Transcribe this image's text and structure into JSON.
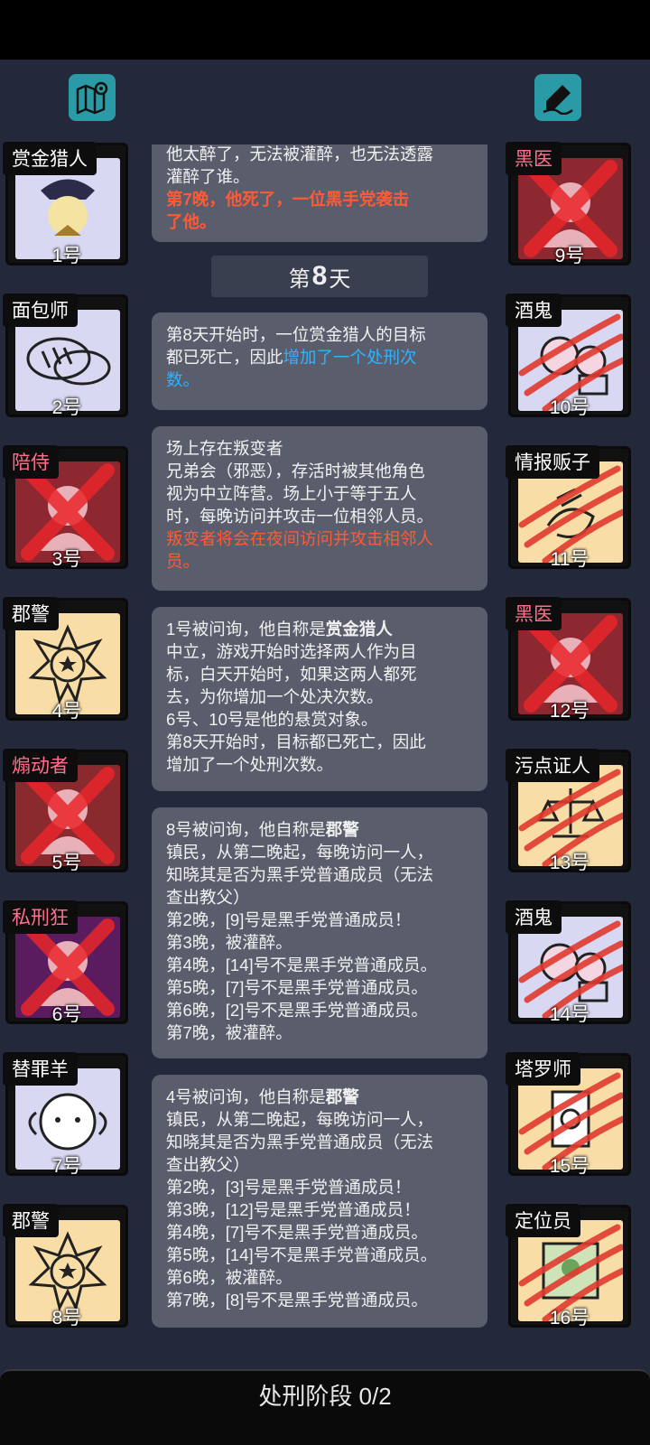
{
  "toolbar": {
    "map_icon": "map-pin-icon",
    "edit_icon": "pen-icon"
  },
  "left_players": [
    {
      "name": "赏金猎人",
      "num": "1号",
      "dead": false,
      "bg": "#d9d8f2"
    },
    {
      "name": "面包师",
      "num": "2号",
      "dead": false,
      "bg": "#d9d8f2"
    },
    {
      "name": "陪侍",
      "num": "3号",
      "dead": true,
      "bg": "#8e2830"
    },
    {
      "name": "郡警",
      "num": "4号",
      "dead": false,
      "bg": "#f9dda6"
    },
    {
      "name": "煽动者",
      "num": "5号",
      "dead": true,
      "bg": "#8a2a2e"
    },
    {
      "name": "私刑狂",
      "num": "6号",
      "dead": true,
      "bg": "#5a1c5e"
    },
    {
      "name": "替罪羊",
      "num": "7号",
      "dead": false,
      "bg": "#d9d8f2"
    },
    {
      "name": "郡警",
      "num": "8号",
      "dead": false,
      "bg": "#f9dda6"
    }
  ],
  "right_players": [
    {
      "name": "黑医",
      "num": "9号",
      "dead": true,
      "bg": "#8e2830"
    },
    {
      "name": "酒鬼",
      "num": "10号",
      "dead": false,
      "bg": "#d9d8f2"
    },
    {
      "name": "情报贩子",
      "num": "11号",
      "dead": false,
      "bg": "#f9dda6"
    },
    {
      "name": "黑医",
      "num": "12号",
      "dead": true,
      "bg": "#8e2830"
    },
    {
      "name": "污点证人",
      "num": "13号",
      "dead": false,
      "bg": "#f9dda6"
    },
    {
      "name": "酒鬼",
      "num": "14号",
      "dead": false,
      "bg": "#d9d8f2"
    },
    {
      "name": "塔罗师",
      "num": "15号",
      "dead": false,
      "bg": "#f9dda6"
    },
    {
      "name": "定位员",
      "num": "16号",
      "dead": false,
      "bg": "#f9dda6"
    }
  ],
  "feed": {
    "msg0": {
      "line1": "他太醉了，无法被灌醉，也无法透露",
      "line2": "灌醉了谁。",
      "red": "第7晚，他死了，一位黑手党袭击\n了他。"
    },
    "day": {
      "prefix": "第",
      "number": "8",
      "suffix": "天"
    },
    "msg1": {
      "text": "第8天开始时，一位赏金猎人的目标\n都已死亡，因此",
      "blue": "增加了一个处刑次\n数。"
    },
    "msg2": {
      "text": "场上存在叛变者\n兄弟会（邪恶），存活时被其他角色\n视为中立阵营。场上小于等于五人\n时，每晚访问并攻击一位相邻人员。",
      "red": "叛变者将会在夜间访问并攻击相邻人\n员。"
    },
    "msg3": {
      "prefix": "1号被问询，他自称是",
      "role": "赏金猎人",
      "text": "中立，游戏开始时选择两人作为目\n标，白天开始时，如果这两人都死\n去，为你增加一个处决次数。\n6号、10号是他的悬赏对象。\n第8天开始时，目标都已死亡，因此\n增加了一个处刑次数。"
    },
    "msg4": {
      "prefix": "8号被问询，他自称是",
      "role": "郡警",
      "text": "镇民，从第二晚起，每晚访问一人，\n知晓其是否为黑手党普通成员（无法\n查出教父）\n第2晚，[9]号是黑手党普通成员！\n第3晚，被灌醉。\n第4晚，[14]号不是黑手党普通成员。\n第5晚，[7]号不是黑手党普通成员。\n第6晚，[2]号不是黑手党普通成员。\n第7晚，被灌醉。"
    },
    "msg5": {
      "prefix": "4号被问询，他自称是",
      "role": "郡警",
      "text": "镇民，从第二晚起，每晚访问一人，\n知晓其是否为黑手党普通成员（无法\n查出教父）\n第2晚，[3]号是黑手党普通成员！\n第3晚，[12]号是黑手党普通成员！\n第4晚，[7]号不是黑手党普通成员。\n第5晚，[14]号不是黑手党普通成员。\n第6晚，被灌醉。\n第7晚，[8]号不是黑手党普通成员。"
    }
  },
  "bottom": {
    "label": "处刑阶段 0/2"
  }
}
